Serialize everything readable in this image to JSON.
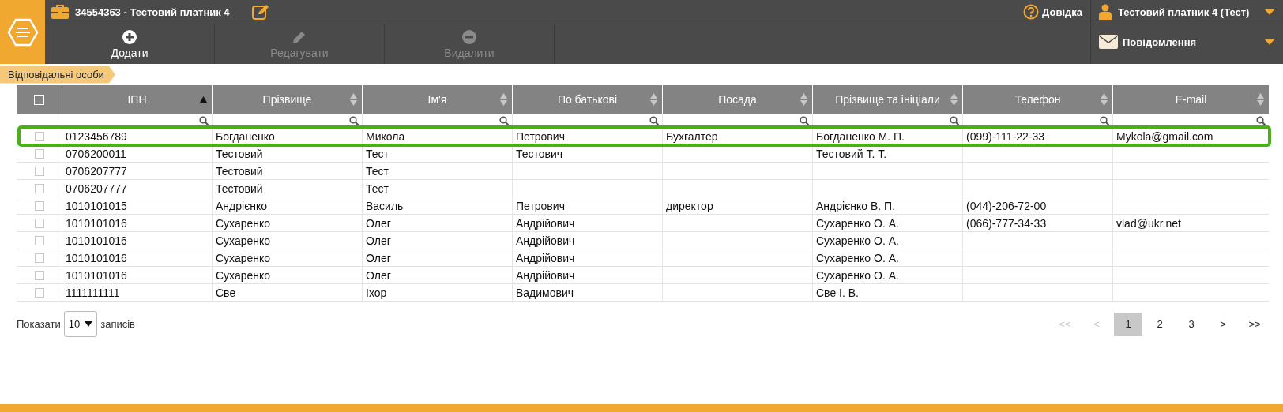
{
  "header": {
    "company": "34554363 - Тестовий платник 4",
    "help": "Довідка",
    "user": "Тестовий платник 4 (Тест)"
  },
  "toolbar": [
    {
      "kind": "add",
      "label": "Додати",
      "disabled": false
    },
    {
      "kind": "edit",
      "label": "Редагувати",
      "disabled": true
    },
    {
      "kind": "delete",
      "label": "Видалити",
      "disabled": true
    }
  ],
  "messages": {
    "label": "Повідомлення"
  },
  "breadcrumb": "Відповідальні особи",
  "table": {
    "select_all": {
      "checked": false
    },
    "columns": [
      {
        "label": "ІПН",
        "sorted": true
      },
      {
        "label": "Прізвище",
        "sorted": false
      },
      {
        "label": "Ім'я",
        "sorted": false
      },
      {
        "label": "По батькові",
        "sorted": false
      },
      {
        "label": "Посада",
        "sorted": false
      },
      {
        "label": "Прізвище та ініціали",
        "sorted": false
      },
      {
        "label": "Телефон",
        "sorted": false
      },
      {
        "label": "E-mail",
        "sorted": false
      }
    ],
    "rows": [
      {
        "checked": false,
        "highlighted": true,
        "cells": [
          "0123456789",
          "Богданенко",
          "Микола",
          "Петрович",
          "Бухгалтер",
          "Богданенко М. П.",
          "(099)-111-22-33",
          "Mykola@gmail.com"
        ]
      },
      {
        "checked": false,
        "highlighted": false,
        "cells": [
          "0706200011",
          "Тестовий",
          "Тест",
          "Тестович",
          null,
          "Тестовий Т. Т.",
          null,
          null
        ]
      },
      {
        "checked": false,
        "highlighted": false,
        "cells": [
          "0706207777",
          "Тестовий",
          "Тест",
          null,
          null,
          null,
          null,
          null
        ]
      },
      {
        "checked": false,
        "highlighted": false,
        "cells": [
          "0706207777",
          "Тестовий",
          "Тест",
          null,
          null,
          null,
          null,
          null
        ]
      },
      {
        "checked": false,
        "highlighted": false,
        "cells": [
          "1010101015",
          "Андрієнко",
          "Василь",
          "Петрович",
          "директор",
          "Андрієнко В. П.",
          "(044)-206-72-00",
          null
        ]
      },
      {
        "checked": false,
        "highlighted": false,
        "cells": [
          "1010101016",
          "Сухаренко",
          "Олег",
          "Андрійович",
          null,
          "Сухаренко О. А.",
          "(066)-777-34-33",
          "vlad@ukr.net"
        ]
      },
      {
        "checked": false,
        "highlighted": false,
        "cells": [
          "1010101016",
          "Сухаренко",
          "Олег",
          "Андрійович",
          null,
          "Сухаренко О. А.",
          null,
          null
        ]
      },
      {
        "checked": false,
        "highlighted": false,
        "cells": [
          "1010101016",
          "Сухаренко",
          "Олег",
          "Андрійович",
          null,
          "Сухаренко О. А.",
          null,
          null
        ]
      },
      {
        "checked": false,
        "highlighted": false,
        "cells": [
          "1010101016",
          "Сухаренко",
          "Олег",
          "Андрійович",
          null,
          "Сухаренко О. А.",
          null,
          null
        ]
      },
      {
        "checked": false,
        "highlighted": false,
        "cells": [
          "1111111111",
          "Све",
          "Іхор",
          "Вадимович",
          null,
          "Све І. В.",
          null,
          null
        ]
      }
    ]
  },
  "page_size": {
    "label_before": "Показати",
    "value": "10",
    "label_after": "записів"
  },
  "pagination": [
    {
      "label": "<<",
      "disabled": true,
      "selected": false
    },
    {
      "label": "<",
      "disabled": true,
      "selected": false
    },
    {
      "label": "1",
      "disabled": false,
      "selected": true
    },
    {
      "label": "2",
      "disabled": false,
      "selected": false
    },
    {
      "label": "3",
      "disabled": false,
      "selected": false
    },
    {
      "label": ">",
      "disabled": false,
      "selected": false
    },
    {
      "label": ">>",
      "disabled": false,
      "selected": false
    }
  ]
}
